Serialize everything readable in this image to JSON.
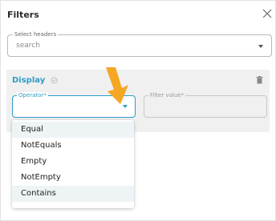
{
  "dialog": {
    "title": "Filters"
  },
  "select_headers": {
    "label": "Select headers",
    "placeholder": "search"
  },
  "display": {
    "label": "Display",
    "operator_label": "Operator*",
    "filter_value_label": "Filter value*"
  },
  "operator_options": [
    "Equal",
    "NotEquals",
    "Empty",
    "NotEmpty",
    "Contains"
  ],
  "colors": {
    "accent": "#2d9cc6",
    "arrow": "#f5a623"
  },
  "icons": {
    "close": "close-icon",
    "display_status": "check-circle-icon",
    "delete": "trash-icon",
    "dropdown": "chevron-down-icon"
  }
}
